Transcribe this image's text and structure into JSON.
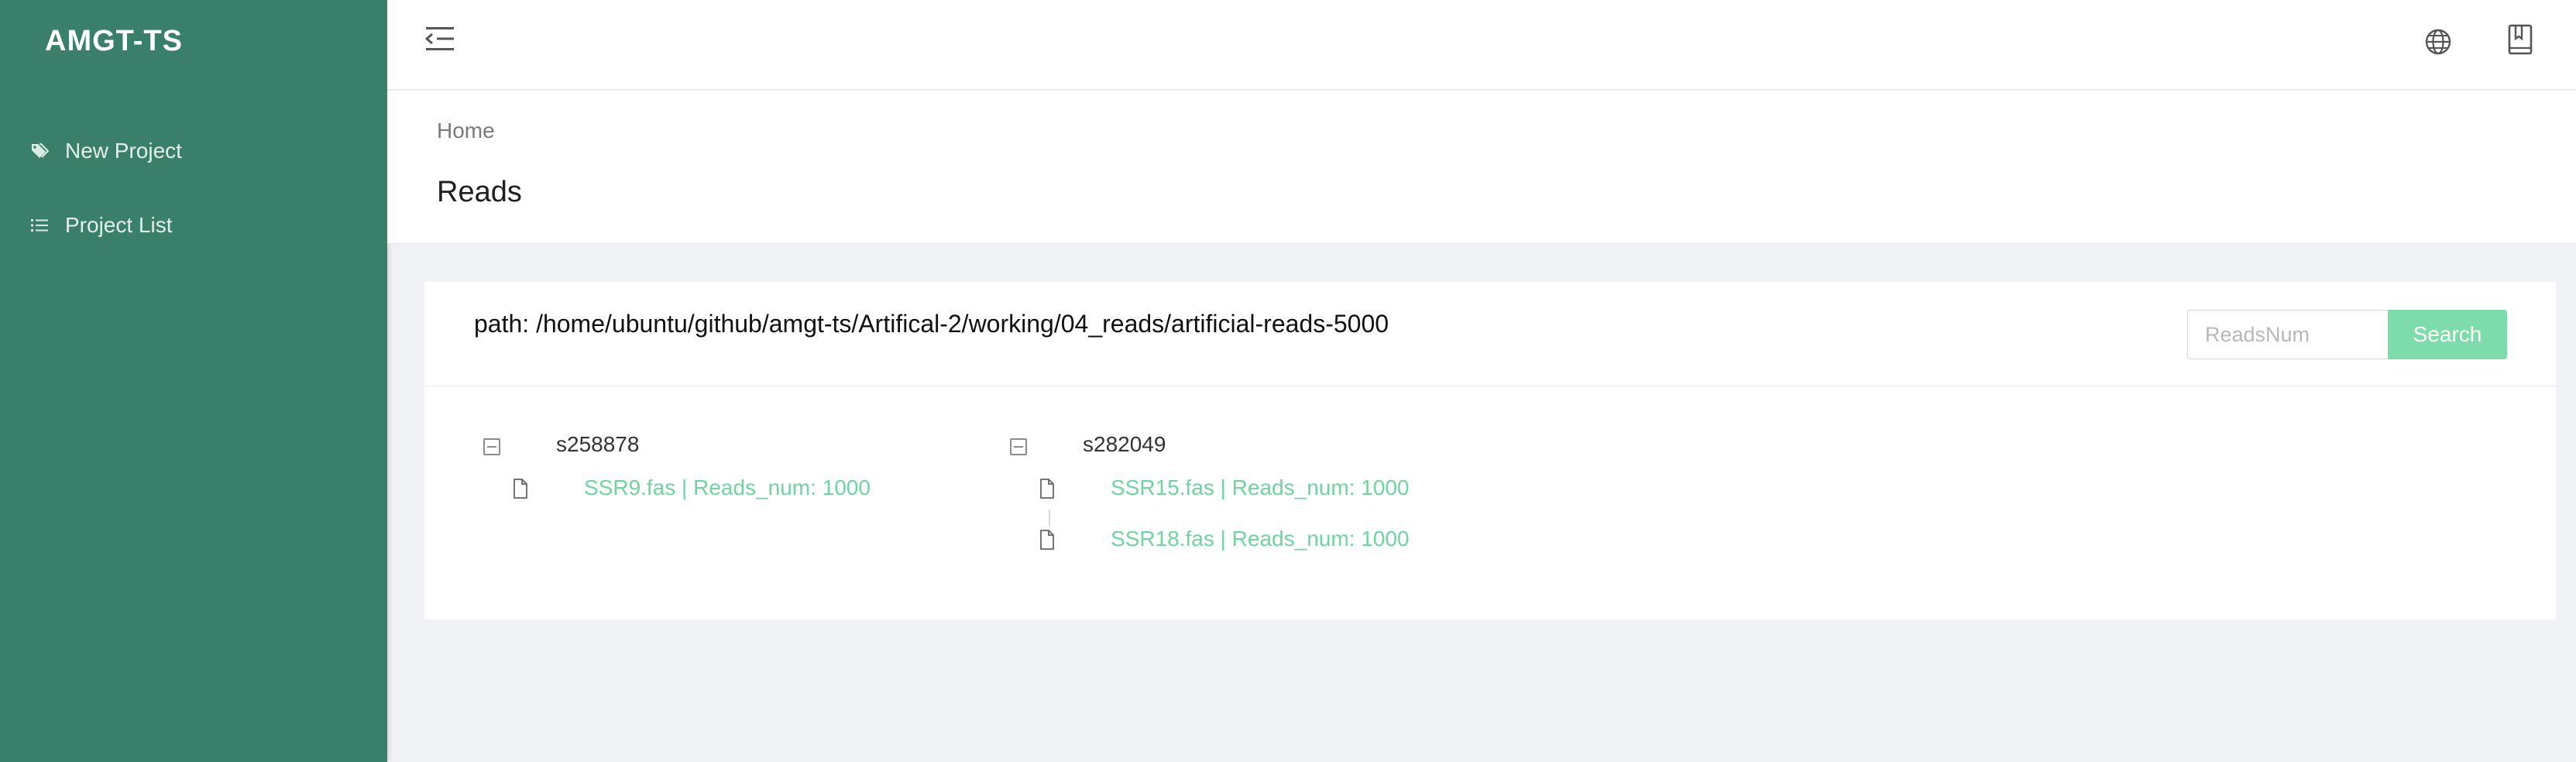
{
  "app": {
    "title": "AMGT-TS"
  },
  "sidebar": {
    "items": [
      {
        "label": "New Project",
        "icon": "tags-icon"
      },
      {
        "label": "Project List",
        "icon": "list-icon"
      }
    ]
  },
  "topbar": {
    "icons": [
      "menu-fold-icon",
      "globe-icon",
      "book-icon"
    ]
  },
  "breadcrumb": {
    "home": "Home"
  },
  "page": {
    "title": "Reads"
  },
  "card": {
    "path": "path: /home/ubuntu/github/amgt-ts/Artifical-2/working/04_reads/artificial-reads-5000",
    "search": {
      "placeholder": "ReadsNum",
      "value": "",
      "button": "Search"
    }
  },
  "tree": [
    {
      "name": "s258878",
      "files": [
        {
          "label": "SSR9.fas | Reads_num: 1000"
        }
      ]
    },
    {
      "name": "s282049",
      "files": [
        {
          "label": "SSR15.fas | Reads_num: 1000"
        },
        {
          "label": "SSR18.fas | Reads_num: 1000"
        }
      ]
    }
  ],
  "colors": {
    "sidebar": "#3a7f6a",
    "accent": "#7ddcab",
    "leaf": "#6fd4a1",
    "background": "#f0f2f5"
  }
}
